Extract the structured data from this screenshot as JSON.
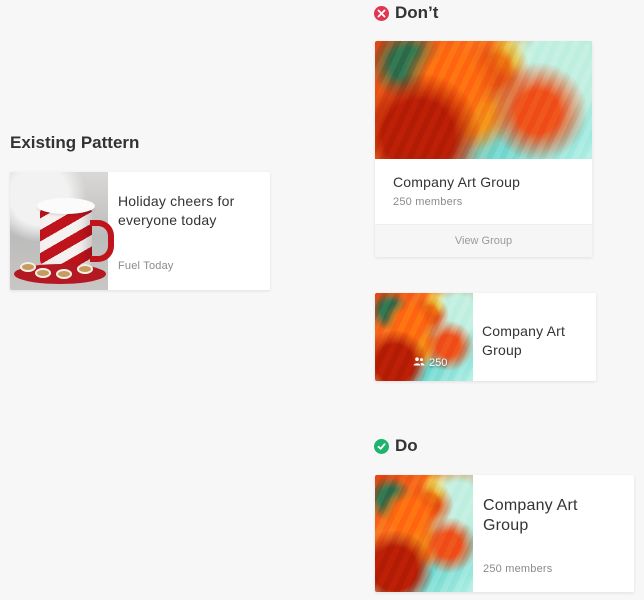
{
  "existing": {
    "heading": "Existing Pattern",
    "card": {
      "title": "Holiday cheers for everyone today",
      "source": "Fuel Today",
      "image_icon": "mug-photo"
    }
  },
  "dont": {
    "heading": "Don’t",
    "icon": "close-circle-icon",
    "icon_color": "#e0364f",
    "large_card": {
      "title": "Company Art Group",
      "members": "250 members",
      "action": "View Group"
    },
    "small_card": {
      "title": "Company Art Group",
      "member_count": "250",
      "members_icon": "people-icon"
    }
  },
  "do": {
    "heading": "Do",
    "icon": "check-circle-icon",
    "icon_color": "#1fb46e",
    "card": {
      "title": "Company Art Group",
      "members": "250 members"
    }
  }
}
